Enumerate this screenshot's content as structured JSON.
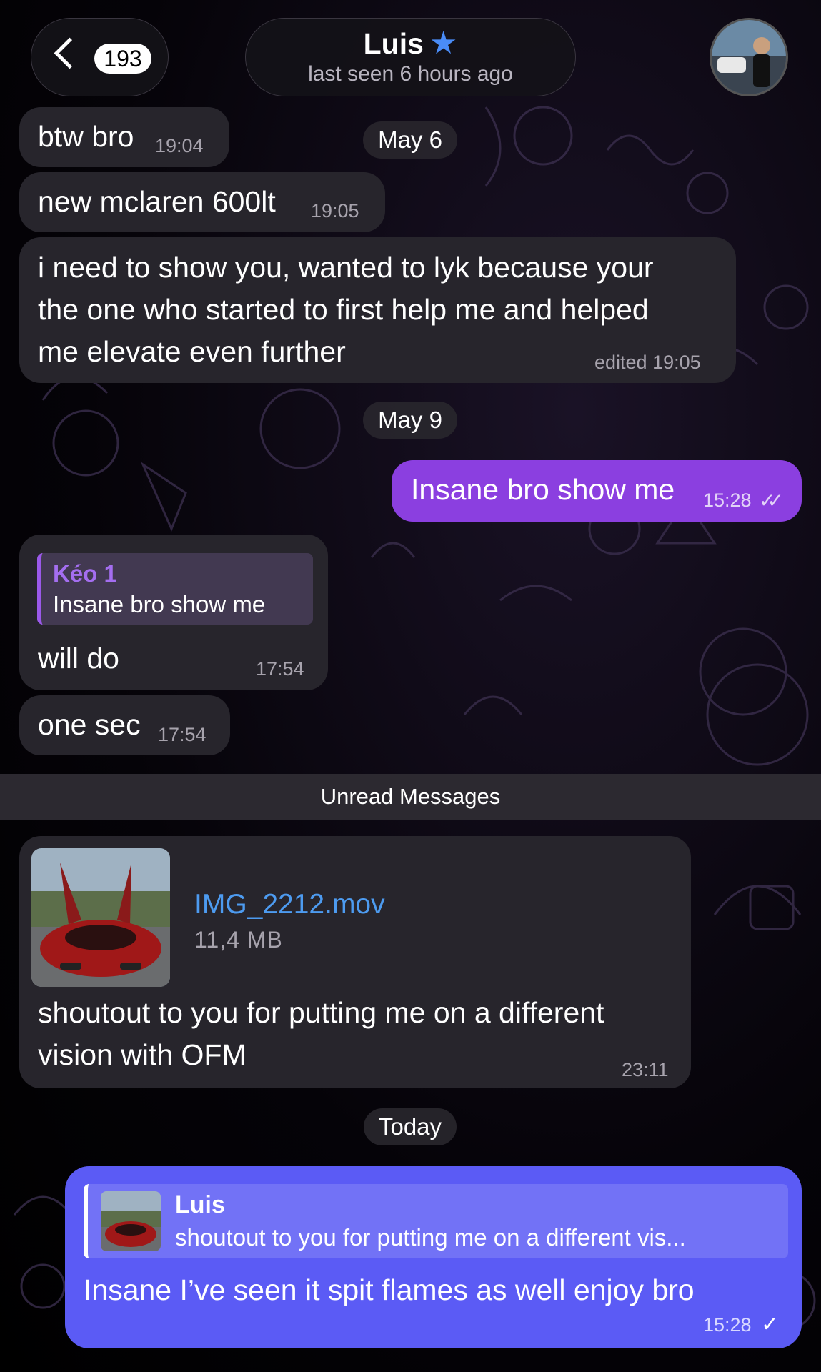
{
  "header": {
    "back_count": "193",
    "contact_name": "Luis",
    "status": "last seen 6 hours ago"
  },
  "dates": {
    "may6": "May 6",
    "may9": "May 9",
    "today": "Today"
  },
  "messages": {
    "m1": {
      "text": "btw bro",
      "time": "19:04"
    },
    "m2": {
      "text": "new mclaren 600lt",
      "time": "19:05"
    },
    "m3": {
      "line1": "i need to show you, wanted to lyk because your",
      "line2": "the one who started to first help me and helped",
      "line3": "me elevate even further",
      "time": "edited 19:05"
    },
    "m4": {
      "text": "Insane bro show me",
      "time": "15:28"
    },
    "m5": {
      "reply_author": "Kéo 1",
      "reply_text": "Insane bro show me",
      "text": "will do",
      "time": "17:54"
    },
    "m6": {
      "text": "one sec",
      "time": "17:54"
    },
    "m7": {
      "file_name": "IMG_2212.mov",
      "file_size": "11,4 MB",
      "line1": "shoutout to you for putting me on a different",
      "line2": "vision with OFM",
      "time": "23:11"
    },
    "m8": {
      "reply_author": "Luis",
      "reply_text": "shoutout to you for putting me on a different vis...",
      "text": "Insane I’ve seen it spit flames as well enjoy bro",
      "time": "15:28"
    }
  },
  "unread_label": "Unread Messages",
  "colors": {
    "outgoing": "#8b3fe0",
    "outgoing_latest": "#5b5bf5",
    "incoming": "#27252c",
    "accent_star": "#4a8cf7",
    "file_link": "#4d9bf0"
  },
  "icons": [
    "back-chevron-icon",
    "star-icon",
    "double-check-icon",
    "single-check-icon"
  ]
}
